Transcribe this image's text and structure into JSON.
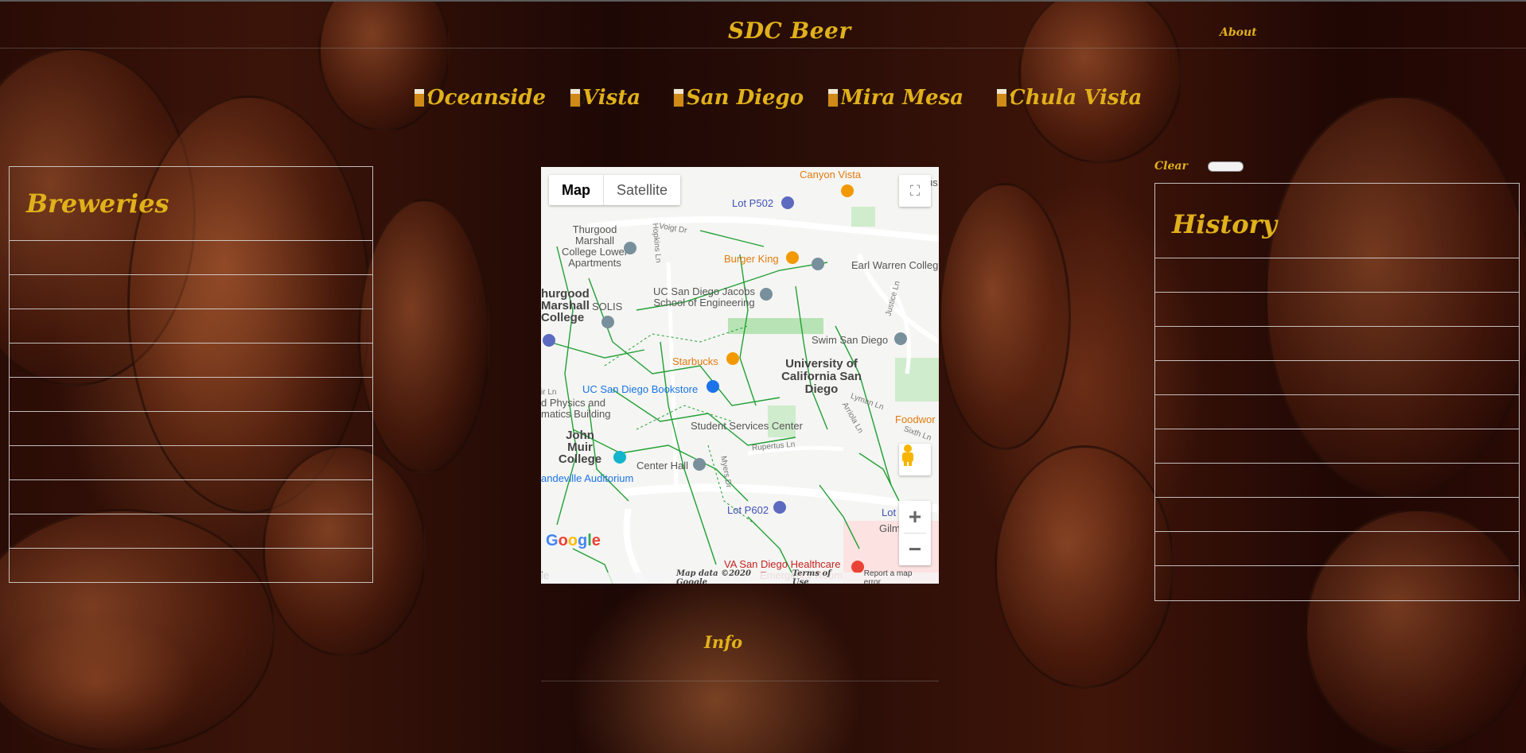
{
  "brand": "SDC Beer",
  "nav": {
    "about": "About"
  },
  "cities": [
    {
      "label": "Oceanside",
      "icon": "beer-mug-icon"
    },
    {
      "label": "Vista",
      "icon": "beer-mug-icon"
    },
    {
      "label": "San Diego",
      "icon": "beer-mug-icon"
    },
    {
      "label": "Mira Mesa",
      "icon": "beer-mug-icon"
    },
    {
      "label": "Chula Vista",
      "icon": "beer-mug-icon"
    }
  ],
  "breweries": {
    "title": "Breweries",
    "rows": [
      "",
      "",
      "",
      "",
      "",
      "",
      "",
      "",
      "",
      ""
    ]
  },
  "history": {
    "title": "History",
    "clear_label": "Clear",
    "rows": [
      "",
      "",
      "",
      "",
      "",
      "",
      "",
      "",
      "",
      ""
    ]
  },
  "map": {
    "type_map": "Map",
    "type_satellite": "Satellite",
    "zoom_in": "+",
    "zoom_out": "−",
    "footer_data": "Map data ©2020 Google",
    "footer_terms": "Terms of Use",
    "footer_report": "Report a map error",
    "labels": {
      "canyon_vista": "Canyon Vista",
      "lot_p502": "Lot P502",
      "thurgood_lower": "Thurgood Marshall College Lower Apartments",
      "burger_king": "Burger King",
      "earl_warren": "Earl Warren College",
      "thurgood_college": "hurgood Marshall College",
      "solis": "SOLIS",
      "jacobs": "UC San Diego Jacobs School of Engineering",
      "swim": "Swim San Diego",
      "starbucks": "Starbucks",
      "ucsd": "University of California San Diego",
      "bookstore": "UC San Diego Bookstore",
      "physics": "d Physics and matics Building",
      "foodworx": "Foodwor",
      "john_muir": "John Muir College",
      "student_services": "Student Services Center",
      "center_hall": "Center Hall",
      "mandeville": "andeville Auditorium",
      "lot_p602": "Lot P602",
      "lot": "Lot",
      "va": "VA San Diego Healthcare",
      "emergency": "Emergency Room",
      "voigt": "Voigt Dr",
      "hopkins": "Hopkins Ln",
      "justice": "Justice Ln",
      "lyman": "Lyman Ln",
      "sixth": "Sixth Ln",
      "rupertus": "Rupertus Ln",
      "myers": "Myers Dr",
      "arriola": "Arriola Ln",
      "gilman": "Gilm",
      "ir_ln": "ir Ln",
      "ie": "le",
      "us": "us"
    }
  },
  "info": {
    "title": "Info"
  },
  "colors": {
    "accent": "#e0b11a",
    "map_green": "#21a035",
    "map_orange": "#e17b0f"
  }
}
